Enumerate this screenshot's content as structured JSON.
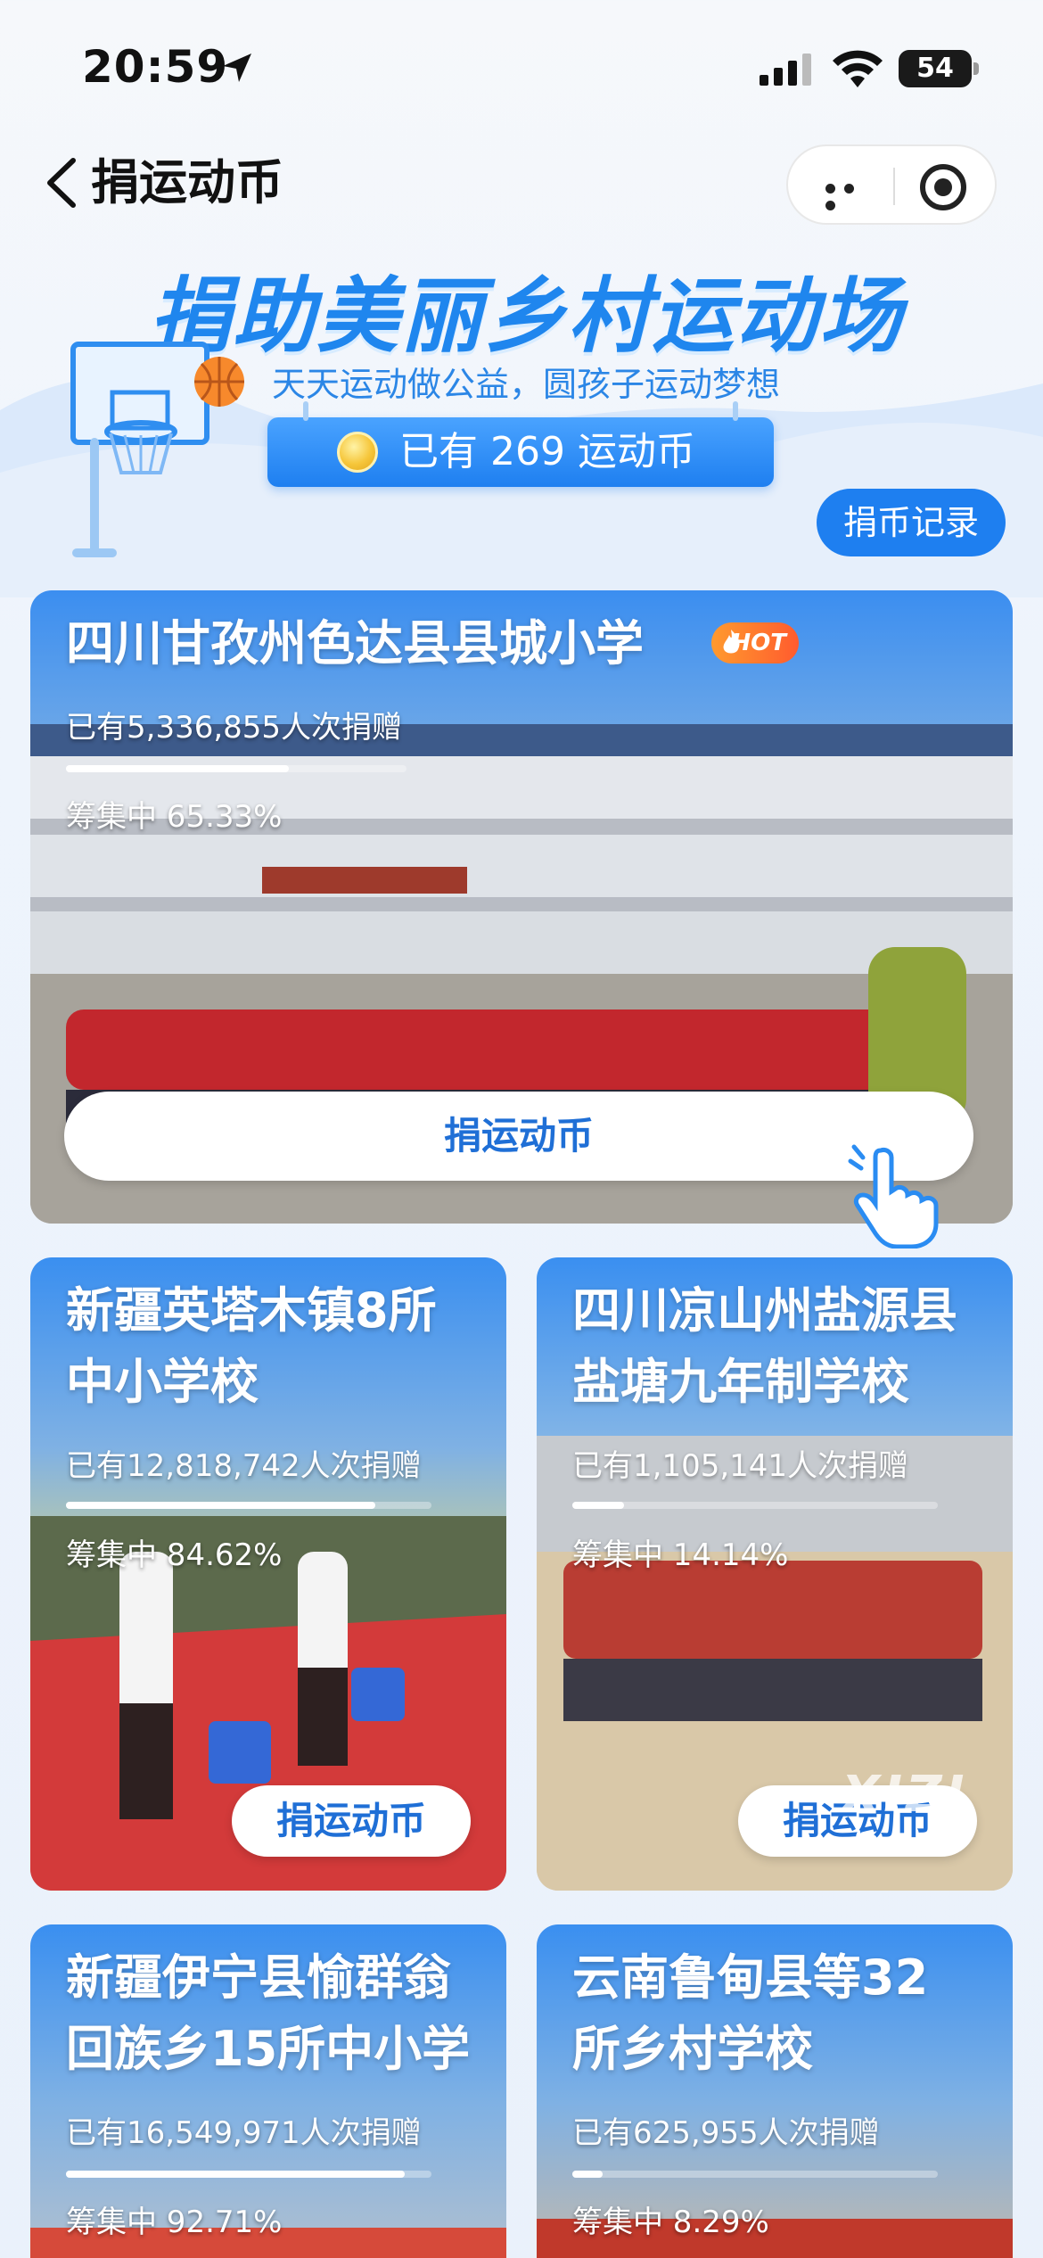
{
  "status_bar": {
    "time": "20:59",
    "battery": "54"
  },
  "nav": {
    "title": "捐运动币"
  },
  "hero": {
    "title": "捐助美丽乡村运动场",
    "subtitle": "天天运动做公益，圆孩子运动梦想",
    "coins": "已有 269 运动币",
    "record_button": "捐币记录"
  },
  "cards": [
    {
      "title": "四川甘孜州色达县县城小学",
      "badge": "HOT",
      "count": "已有5,336,855人次捐赠",
      "percent_label": "筹集中 65.33%",
      "progress": 0.6533,
      "button": "捐运动币"
    },
    {
      "title_line1": "新疆英塔木镇8所",
      "title_line2": "中小学校",
      "count": "已有12,818,742人次捐赠",
      "percent_label": "筹集中 84.62%",
      "progress": 0.8462,
      "button": "捐运动币"
    },
    {
      "title_line1": "四川凉山州盐源县",
      "title_line2": "盐塘九年制学校",
      "count": "已有1,105,141人次捐赠",
      "percent_label": "筹集中 14.14%",
      "progress": 0.1414,
      "button": "捐运动币"
    },
    {
      "title_line1": "新疆伊宁县愉群翁",
      "title_line2": "回族乡15所中小学",
      "count": "已有16,549,971人次捐赠",
      "percent_label": "筹集中 92.71%",
      "progress": 0.9271
    },
    {
      "title_line1": "云南鲁甸县等32",
      "title_line2": "所乡村学校",
      "count": "已有625,955人次捐赠",
      "percent_label": "筹集中 8.29%",
      "progress": 0.0829
    }
  ],
  "watermark": "XIZI",
  "colors": {
    "accent": "#1e7ff0",
    "title_blue": "#1f86ee",
    "button_text": "#1f6fd6"
  }
}
